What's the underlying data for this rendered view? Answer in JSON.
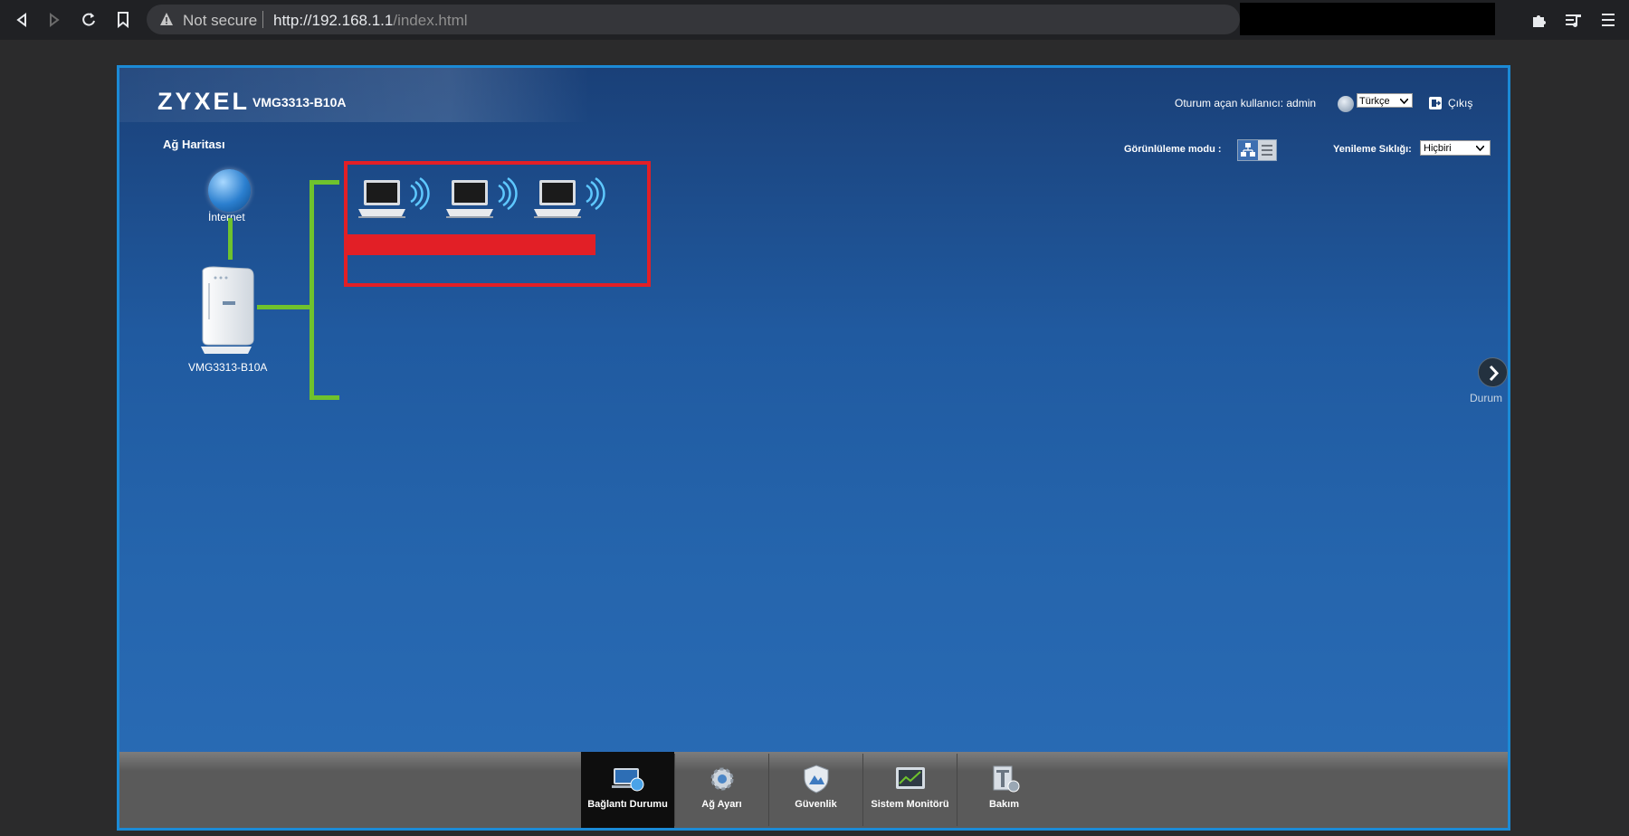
{
  "browser": {
    "security_text": "Not secure",
    "url_host": "http://192.168.1.1",
    "url_path": "/index.html"
  },
  "router": {
    "brand": "ZYXEL",
    "model": "VMG3313-B10A",
    "user_label": "Oturum açan kullanıcı: admin",
    "language": "Türkçe",
    "logout": "Çıkış",
    "view_mode_label": "Görünlüleme modu :",
    "refresh_label": "Yenileme Sıklığı:",
    "refresh_value": "Hiçbiri",
    "map_title": "Ağ Haritası",
    "internet_label": "İnternet",
    "router_label": "VMG3313-B10A",
    "status_label": "Durum",
    "toolbar": [
      {
        "label": "Bağlantı Durumu",
        "active": true
      },
      {
        "label": "Ağ Ayarı",
        "active": false
      },
      {
        "label": "Güvenlik",
        "active": false
      },
      {
        "label": "Sistem Monitörü",
        "active": false
      },
      {
        "label": "Bakım",
        "active": false
      }
    ]
  },
  "colors": {
    "accent_green": "#6fc22d",
    "highlight_red": "#e21f26",
    "frame_border": "#1b8ad6"
  }
}
